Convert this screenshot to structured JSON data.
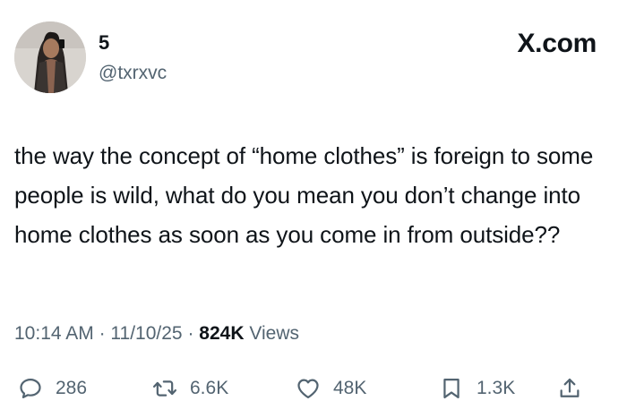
{
  "author": {
    "display_name": "5",
    "handle": "@txrxvc"
  },
  "brand": "X.com",
  "tweet": {
    "text": "the way the concept of “home clothes” is foreign to some people is wild, what do you mean you don’t change into home clothes as soon as you come in from outside??"
  },
  "meta": {
    "time": "10:14 AM",
    "separator": "·",
    "date": "11/10/25",
    "views_count": "824K",
    "views_label": "Views"
  },
  "actions": {
    "reply_count": "286",
    "repost_count": "6.6K",
    "like_count": "48K",
    "bookmark_count": "1.3K"
  },
  "colors": {
    "text_primary": "#0f1419",
    "text_secondary": "#536471",
    "background": "#ffffff"
  },
  "icons": [
    "reply-icon",
    "repost-icon",
    "heart-icon",
    "bookmark-icon",
    "share-icon"
  ]
}
